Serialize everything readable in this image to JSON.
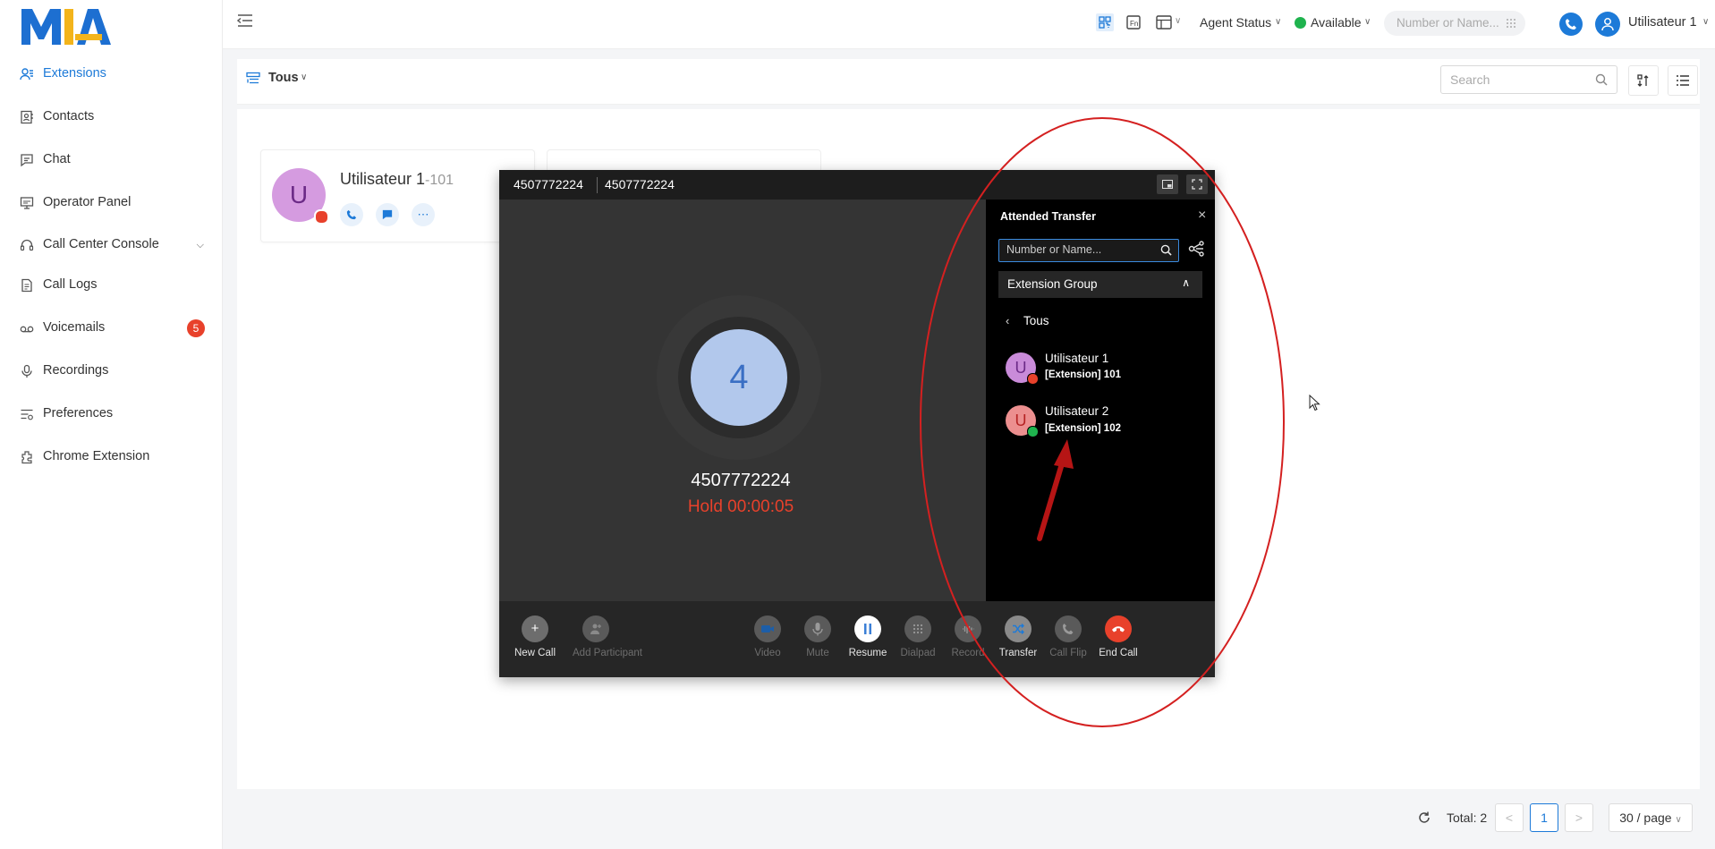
{
  "brand": {
    "logo_text": "MIA",
    "accent": "#1d7ad8",
    "danger": "#e8412b",
    "success": "#1fb34e"
  },
  "sidebar": {
    "items": [
      {
        "label": "Extensions",
        "icon": "user-list-icon",
        "active": true
      },
      {
        "label": "Contacts",
        "icon": "contacts-icon"
      },
      {
        "label": "Chat",
        "icon": "chat-icon"
      },
      {
        "label": "Operator Panel",
        "icon": "operator-panel-icon"
      },
      {
        "label": "Call Center Console",
        "icon": "headset-icon",
        "expandable": true
      },
      {
        "label": "Call Logs",
        "icon": "call-logs-icon"
      },
      {
        "label": "Voicemails",
        "icon": "voicemail-icon",
        "badge": "5"
      },
      {
        "label": "Recordings",
        "icon": "microphone-icon"
      },
      {
        "label": "Preferences",
        "icon": "preferences-icon"
      },
      {
        "label": "Chrome Extension",
        "icon": "chrome-extension-icon"
      }
    ]
  },
  "header": {
    "agent_status": "Agent Status",
    "presence": "Available",
    "search_placeholder": "Number or Name...",
    "user": "Utilisateur 1"
  },
  "main": {
    "group": "Tous",
    "search_placeholder": "Search",
    "cards": [
      {
        "initial": "U",
        "name": "Utilisateur 1",
        "ext": "-101",
        "status_color": "#e8412b"
      }
    ],
    "pagination": {
      "total": "Total: 2",
      "current": "1",
      "page_size": "30 / page",
      "prev": "<",
      "next": ">"
    }
  },
  "call": {
    "tab1": "4507772224",
    "tab2": "4507772224",
    "avatar_initial": "4",
    "number": "4507772224",
    "hold_status": "Hold 00:00:05",
    "buttons": [
      {
        "label": "New Call",
        "icon": "plus-icon",
        "enabled": true
      },
      {
        "label": "Add Participant",
        "icon": "add-participant-icon",
        "enabled": false
      },
      {
        "label": "Video",
        "icon": "video-icon",
        "enabled": false
      },
      {
        "label": "Mute",
        "icon": "mute-icon",
        "enabled": false
      },
      {
        "label": "Resume",
        "icon": "pause-icon",
        "enabled": true
      },
      {
        "label": "Dialpad",
        "icon": "dialpad-icon",
        "enabled": false
      },
      {
        "label": "Record",
        "icon": "record-icon",
        "enabled": false
      },
      {
        "label": "Transfer",
        "icon": "transfer-icon",
        "enabled": true
      },
      {
        "label": "Call Flip",
        "icon": "call-flip-icon",
        "enabled": false
      },
      {
        "label": "End Call",
        "icon": "end-call-icon",
        "enabled": true
      }
    ]
  },
  "transfer": {
    "title": "Attended Transfer",
    "search_placeholder": "Number or Name...",
    "group_label": "Extension Group",
    "back_label": "Tous",
    "contacts": [
      {
        "initial": "U",
        "name": "Utilisateur 1",
        "ext": "[Extension] 101",
        "avatar_color": "#c98bd9",
        "status_color": "#e8412b"
      },
      {
        "initial": "U",
        "name": "Utilisateur 2",
        "ext": "[Extension] 102",
        "avatar_color": "#ec8f8f",
        "status_color": "#1fb34e"
      }
    ]
  }
}
